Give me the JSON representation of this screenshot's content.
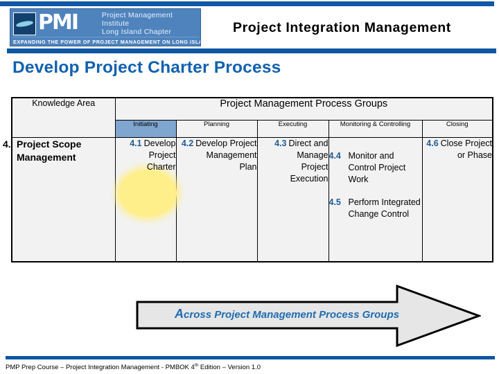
{
  "header": {
    "title": "Project Integration Management",
    "logo": {
      "acronym": "PMI",
      "line1": "Project Management Institute",
      "line2": "Long Island Chapter",
      "tagline": "EXPANDING THE POWER OF PROJECT MANAGEMENT ON LONG ISLAND"
    }
  },
  "slide": {
    "title": "Develop Project Charter Process"
  },
  "matrix": {
    "knowledge_area_header": "Knowledge Area",
    "process_groups_header": "Project Management Process Groups",
    "process_groups": [
      {
        "label": "Initiating",
        "highlighted": true
      },
      {
        "label": "Planning",
        "highlighted": false
      },
      {
        "label": "Executing",
        "highlighted": false
      },
      {
        "label": "Monitoring & Controlling",
        "highlighted": false
      },
      {
        "label": "Closing",
        "highlighted": false
      }
    ],
    "row": {
      "knowledge_area_number": "4.",
      "knowledge_area_name": "Project Scope Management",
      "initiating": [
        {
          "num": "4.1",
          "text": "Develop Project Charter",
          "highlighted": true
        }
      ],
      "planning": [
        {
          "num": "4.2",
          "text": "Develop Project Management Plan"
        }
      ],
      "executing": [
        {
          "num": "4.3",
          "text": "Direct and Manage Project Execution"
        }
      ],
      "monitoring": [
        {
          "num": "4.4",
          "text": "Monitor and Control Project Work"
        },
        {
          "num": "4.5",
          "text": "Perform Integrated Change Control"
        }
      ],
      "closing": [
        {
          "num": "4.6",
          "text": "Close Project or Phase"
        }
      ]
    }
  },
  "arrow": {
    "first_letter": "A",
    "label_rest": "cross Project Management Process Groups",
    "full_label": "Across Project Management Process Groups"
  },
  "footer": {
    "prefix": "PMP Prep Course – Project Integration Management - PMBOK 4",
    "superscript": "th",
    "suffix": " Edition – Version 1.0"
  },
  "colors": {
    "brand_blue": "#0d57a4",
    "title_blue": "#1161b0",
    "process_num_blue": "#1f5c96",
    "highlight_yellow": "#ffef8a",
    "header_cell_blue": "#7fa6cf",
    "table_fill": "#f2f2f2"
  }
}
